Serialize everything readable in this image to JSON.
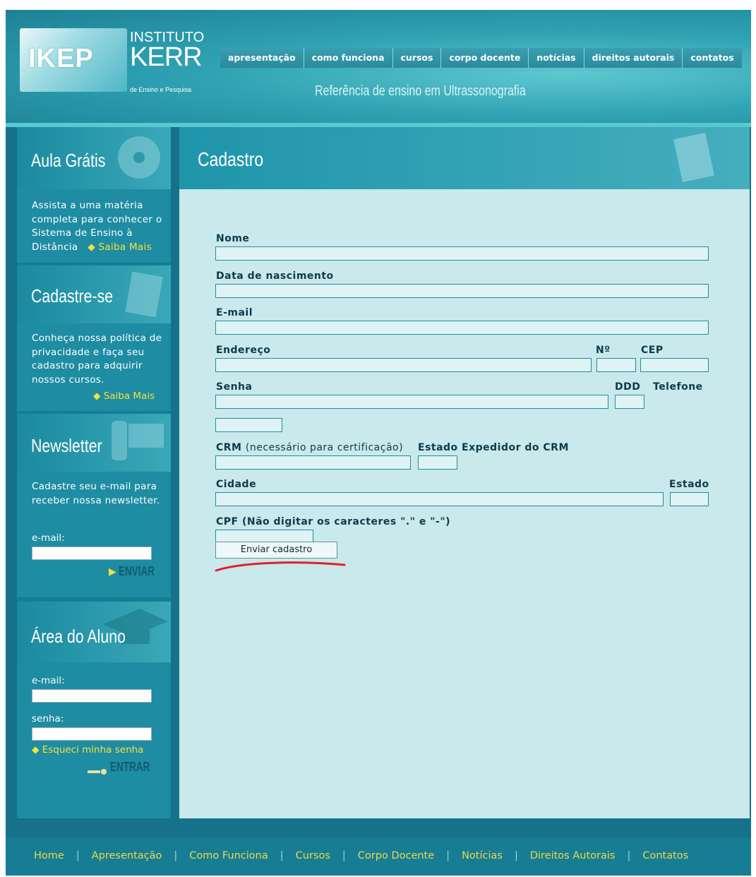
{
  "header": {
    "logo": {
      "mark": "IKEP",
      "line1": "INSTITUTO",
      "line2": "KERR",
      "line3": "de Ensino e Pesquisa"
    },
    "slogan": "Referência de ensino em Ultrassonografia",
    "nav": [
      "apresentação",
      "como funciona",
      "cursos",
      "corpo docente",
      "notícias",
      "direitos autorais",
      "contatos"
    ]
  },
  "sidebar": {
    "aula": {
      "title": "Aula Grátis",
      "text": "Assista a uma matéria completa para conhecer o Sistema de Ensino à Distância",
      "link": "Saiba Mais"
    },
    "cadastre": {
      "title": "Cadastre-se",
      "text": "Conheça nossa política de privacidade e faça seu cadastro para adquirir nossos cursos.",
      "link": "Saiba Mais"
    },
    "newsletter": {
      "title": "Newsletter",
      "text": "Cadastre seu e-mail para receber nossa newsletter.",
      "email_label": "e-mail:",
      "button": "ENVIAR"
    },
    "aluno": {
      "title": "Área do Aluno",
      "email_label": "e-mail:",
      "senha_label": "senha:",
      "forgot": "Esqueci minha senha",
      "button": "ENTRAR"
    }
  },
  "main": {
    "title": "Cadastro",
    "form": {
      "nome": "Nome",
      "nascimento": "Data de nascimento",
      "email": "E-mail",
      "endereco": "Endereço",
      "numero": "Nº",
      "cep": "CEP",
      "senha": "Senha",
      "ddd": "DDD",
      "telefone": "Telefone",
      "crm": "CRM",
      "crm_note": "(necessário para certificação)",
      "estado_crm": "Estado Expedidor do CRM",
      "cidade": "Cidade",
      "estado": "Estado",
      "cpf": "CPF (Não digitar os caracteres \".\" e \"-\")",
      "submit": "Enviar cadastro"
    }
  },
  "footer": {
    "links": [
      "Home",
      "Apresentação",
      "Como Funciona",
      "Cursos",
      "Corpo Docente",
      "Notícias",
      "Direitos Autorais",
      "Contatos"
    ]
  },
  "colors": {
    "teal_dark": "#167d94",
    "teal_light": "#c9e9ec",
    "link_yellow": "#f5e23a",
    "highlight_red": "#e0202a"
  }
}
